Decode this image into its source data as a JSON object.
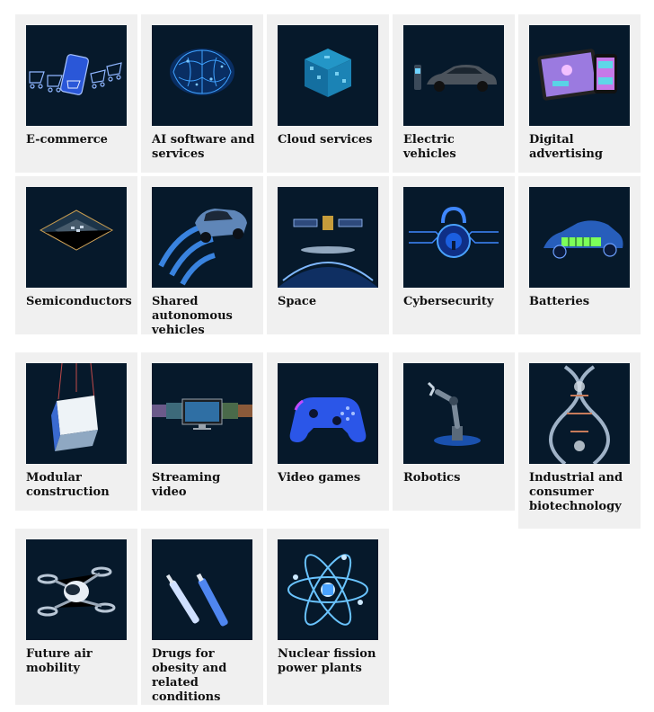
{
  "cards": [
    {
      "label": "E-commerce",
      "icon": "shopping-carts-icon"
    },
    {
      "label": "AI software and services",
      "icon": "brain-icon"
    },
    {
      "label": "Cloud services",
      "icon": "cloud-cube-icon"
    },
    {
      "label": "Electric vehicles",
      "icon": "electric-car-icon"
    },
    {
      "label": "Digital advertising",
      "icon": "tablet-phone-icon"
    },
    {
      "label": "Semiconductors",
      "icon": "microchip-icon"
    },
    {
      "label": "Shared autonomous vehicles",
      "icon": "autonomous-car-icon"
    },
    {
      "label": "Space",
      "icon": "satellite-icon"
    },
    {
      "label": "Cybersecurity",
      "icon": "padlock-icon"
    },
    {
      "label": "Batteries",
      "icon": "battery-car-icon"
    },
    {
      "label": "Modular construction",
      "icon": "crane-module-icon"
    },
    {
      "label": "Streaming video",
      "icon": "screens-icon"
    },
    {
      "label": "Video games",
      "icon": "gamepad-icon"
    },
    {
      "label": "Robotics",
      "icon": "robot-arm-icon"
    },
    {
      "label": "Industrial and consumer biotechnology",
      "icon": "dna-icon"
    },
    {
      "label": "Future air mobility",
      "icon": "drone-taxi-icon"
    },
    {
      "label": "Drugs for obesity and related conditions",
      "icon": "injection-pen-icon"
    },
    {
      "label": "Nuclear fission power plants",
      "icon": "atom-icon"
    }
  ],
  "colors": {
    "card_bg": "#f0f0f0",
    "thumb_bg": "#06192b",
    "accent": "#4aa3ff"
  }
}
